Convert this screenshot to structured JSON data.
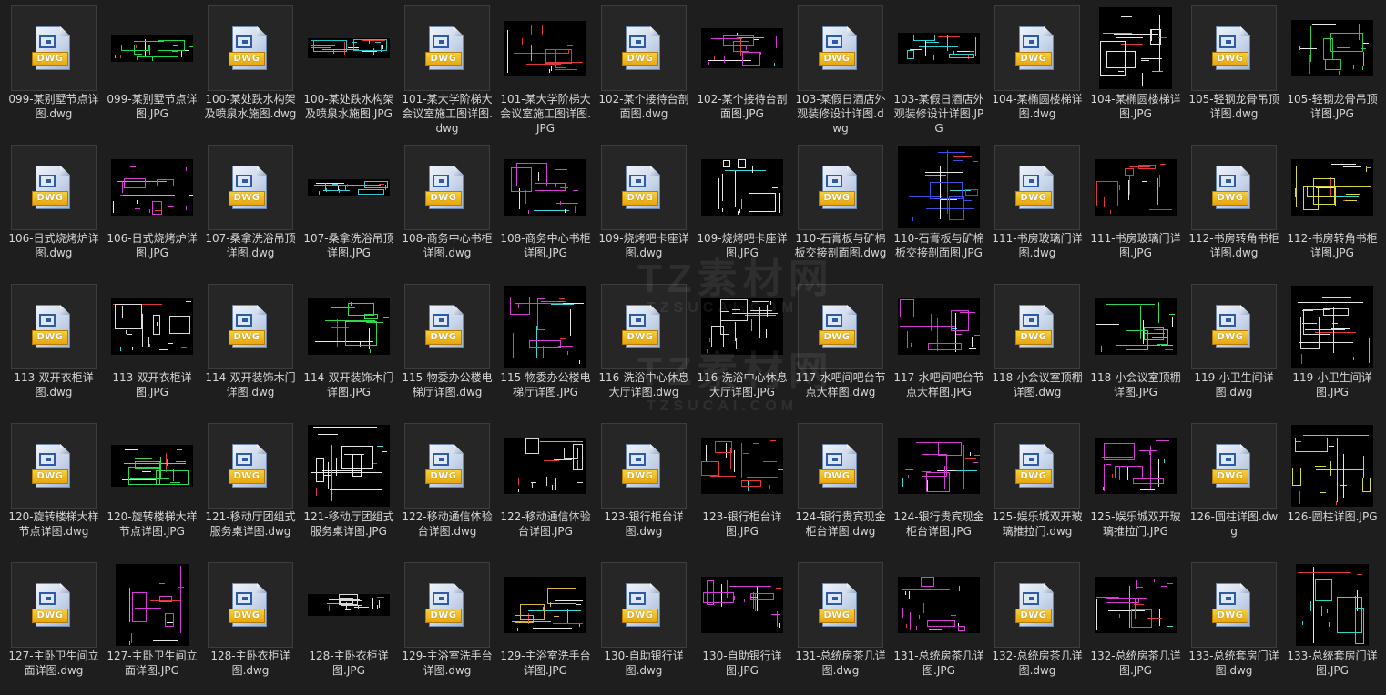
{
  "icon_label": "DWG",
  "watermark": {
    "brand": "TZ素材网",
    "url": "TZSUCAI.COM"
  },
  "files": [
    {
      "name": "099-某别墅节点详图.dwg",
      "type": "dwg"
    },
    {
      "name": "099-某别墅节点详图.JPG",
      "type": "jpg",
      "hue": "#19d94a"
    },
    {
      "name": "100-某处跌水构架及喷泉水施图.dwg",
      "type": "dwg"
    },
    {
      "name": "100-某处跌水构架及喷泉水施图.JPG",
      "type": "jpg",
      "hue": "#17c9c9"
    },
    {
      "name": "101-某大学阶梯大会议室施工图详图.dwg",
      "type": "dwg"
    },
    {
      "name": "101-某大学阶梯大会议室施工图详图.JPG",
      "type": "jpg",
      "hue": "#e2383a"
    },
    {
      "name": "102-某个接待台剖面图.dwg",
      "type": "dwg"
    },
    {
      "name": "102-某个接待台剖面图.JPG",
      "type": "jpg",
      "hue": "#d838d8"
    },
    {
      "name": "103-某假日酒店外观装修设计详图.dwg",
      "type": "dwg"
    },
    {
      "name": "103-某假日酒店外观装修设计详图.JPG",
      "type": "jpg",
      "hue": "#2fd0d0"
    },
    {
      "name": "104-某椭圆楼梯详图.dwg",
      "type": "dwg"
    },
    {
      "name": "104-某椭圆楼梯详图.JPG",
      "type": "jpg",
      "hue": "#e6e6e6"
    },
    {
      "name": "105-轻钢龙骨吊顶详图.dwg",
      "type": "dwg"
    },
    {
      "name": "105-轻钢龙骨吊顶详图.JPG",
      "type": "jpg",
      "hue": "#28c850"
    },
    {
      "name": "106-日式烧烤炉详图.dwg",
      "type": "dwg"
    },
    {
      "name": "106-日式烧烤炉详图.JPG",
      "type": "jpg",
      "hue": "#d93bd9"
    },
    {
      "name": "107-桑拿洗浴吊顶详图.dwg",
      "type": "dwg"
    },
    {
      "name": "107-桑拿洗浴吊顶详图.JPG",
      "type": "jpg",
      "hue": "#35c8d8"
    },
    {
      "name": "108-商务中心书柜详图.dwg",
      "type": "dwg"
    },
    {
      "name": "108-商务中心书柜详图.JPG",
      "type": "jpg",
      "hue": "#d83dd8"
    },
    {
      "name": "109-烧烤吧卡座详图.dwg",
      "type": "dwg"
    },
    {
      "name": "109-烧烤吧卡座详图.JPG",
      "type": "jpg",
      "hue": "#e8e8e8"
    },
    {
      "name": "110-石膏板与矿棉板交接剖面图.dwg",
      "type": "dwg"
    },
    {
      "name": "110-石膏板与矿棉板交接剖面图.JPG",
      "type": "jpg",
      "hue": "#3a50e0"
    },
    {
      "name": "111-书房玻璃门详图.dwg",
      "type": "dwg"
    },
    {
      "name": "111-书房玻璃门详图.JPG",
      "type": "jpg",
      "hue": "#e03a3a"
    },
    {
      "name": "112-书房转角书柜详图.dwg",
      "type": "dwg"
    },
    {
      "name": "112-书房转角书柜详图.JPG",
      "type": "jpg",
      "hue": "#d8d838"
    },
    {
      "name": "113-双开衣柜详图.dwg",
      "type": "dwg"
    },
    {
      "name": "113-双开衣柜详图.JPG",
      "type": "jpg",
      "hue": "#dcdcdc"
    },
    {
      "name": "114-双开装饰木门详图.dwg",
      "type": "dwg"
    },
    {
      "name": "114-双开装饰木门详图.JPG",
      "type": "jpg",
      "hue": "#2ed84a"
    },
    {
      "name": "115-物委办公楼电梯厅详图.dwg",
      "type": "dwg"
    },
    {
      "name": "115-物委办公楼电梯厅详图.JPG",
      "type": "jpg",
      "hue": "#d83ad8"
    },
    {
      "name": "116-洗浴中心休息大厅详图.dwg",
      "type": "dwg"
    },
    {
      "name": "116-洗浴中心休息大厅详图.JPG",
      "type": "jpg",
      "hue": "#d8d8d8"
    },
    {
      "name": "117-水吧间吧台节点大样图.dwg",
      "type": "dwg"
    },
    {
      "name": "117-水吧间吧台节点大样图.JPG",
      "type": "jpg",
      "hue": "#d83ad8"
    },
    {
      "name": "118-小会议室顶棚详图.dwg",
      "type": "dwg"
    },
    {
      "name": "118-小会议室顶棚详图.JPG",
      "type": "jpg",
      "hue": "#2ed860"
    },
    {
      "name": "119-小卫生间详图.dwg",
      "type": "dwg"
    },
    {
      "name": "119-小卫生间详图.JPG",
      "type": "jpg",
      "hue": "#d8d8d8"
    },
    {
      "name": "120-旋转楼梯大样节点详图.dwg",
      "type": "dwg"
    },
    {
      "name": "120-旋转楼梯大样节点详图.JPG",
      "type": "jpg",
      "hue": "#2ed84a"
    },
    {
      "name": "121-移动厅团组式服务桌详图.dwg",
      "type": "dwg"
    },
    {
      "name": "121-移动厅团组式服务桌详图.JPG",
      "type": "jpg",
      "hue": "#e8e8e8"
    },
    {
      "name": "122-移动通信体验台详图.dwg",
      "type": "dwg"
    },
    {
      "name": "122-移动通信体验台详图.JPG",
      "type": "jpg",
      "hue": "#d8d8d8"
    },
    {
      "name": "123-银行柜台详图.dwg",
      "type": "dwg"
    },
    {
      "name": "123-银行柜台详图.JPG",
      "type": "jpg",
      "hue": "#e03a3a"
    },
    {
      "name": "124-银行贵宾现金柜台详图.dwg",
      "type": "dwg"
    },
    {
      "name": "124-银行贵宾现金柜台详图.JPG",
      "type": "jpg",
      "hue": "#d83ad8"
    },
    {
      "name": "125-娱乐城双开玻璃推拉门.dwg",
      "type": "dwg"
    },
    {
      "name": "125-娱乐城双开玻璃推拉门.JPG",
      "type": "jpg",
      "hue": "#d83ad8"
    },
    {
      "name": "126-圆柱详图.dwg",
      "type": "dwg"
    },
    {
      "name": "126-圆柱详图.JPG",
      "type": "jpg",
      "hue": "#d8d838"
    },
    {
      "name": "127-主卧卫生间立面详图.dwg",
      "type": "dwg"
    },
    {
      "name": "127-主卧卫生间立面详图.JPG",
      "type": "jpg",
      "hue": "#d83ad8"
    },
    {
      "name": "128-主卧衣柜详图.dwg",
      "type": "dwg"
    },
    {
      "name": "128-主卧衣柜详图.JPG",
      "type": "jpg",
      "hue": "#d8d8d8"
    },
    {
      "name": "129-主浴室洗手台详图.dwg",
      "type": "dwg"
    },
    {
      "name": "129-主浴室洗手台详图.JPG",
      "type": "jpg",
      "hue": "#d8b838"
    },
    {
      "name": "130-自助银行详图.dwg",
      "type": "dwg"
    },
    {
      "name": "130-自助银行详图.JPG",
      "type": "jpg",
      "hue": "#d83ad8"
    },
    {
      "name": "131-总统房茶几详图.dwg",
      "type": "dwg"
    },
    {
      "name": "131-总统房茶几详图.JPG",
      "type": "jpg",
      "hue": "#d83ad8"
    },
    {
      "name": "132-总统房茶几详图.dwg",
      "type": "dwg"
    },
    {
      "name": "132-总统房茶几详图.JPG",
      "type": "jpg",
      "hue": "#d83ad8"
    },
    {
      "name": "133-总统套房门详图.dwg",
      "type": "dwg"
    },
    {
      "name": "133-总统套房门详图.JPG",
      "type": "jpg",
      "hue": "#2ed8c0"
    }
  ]
}
